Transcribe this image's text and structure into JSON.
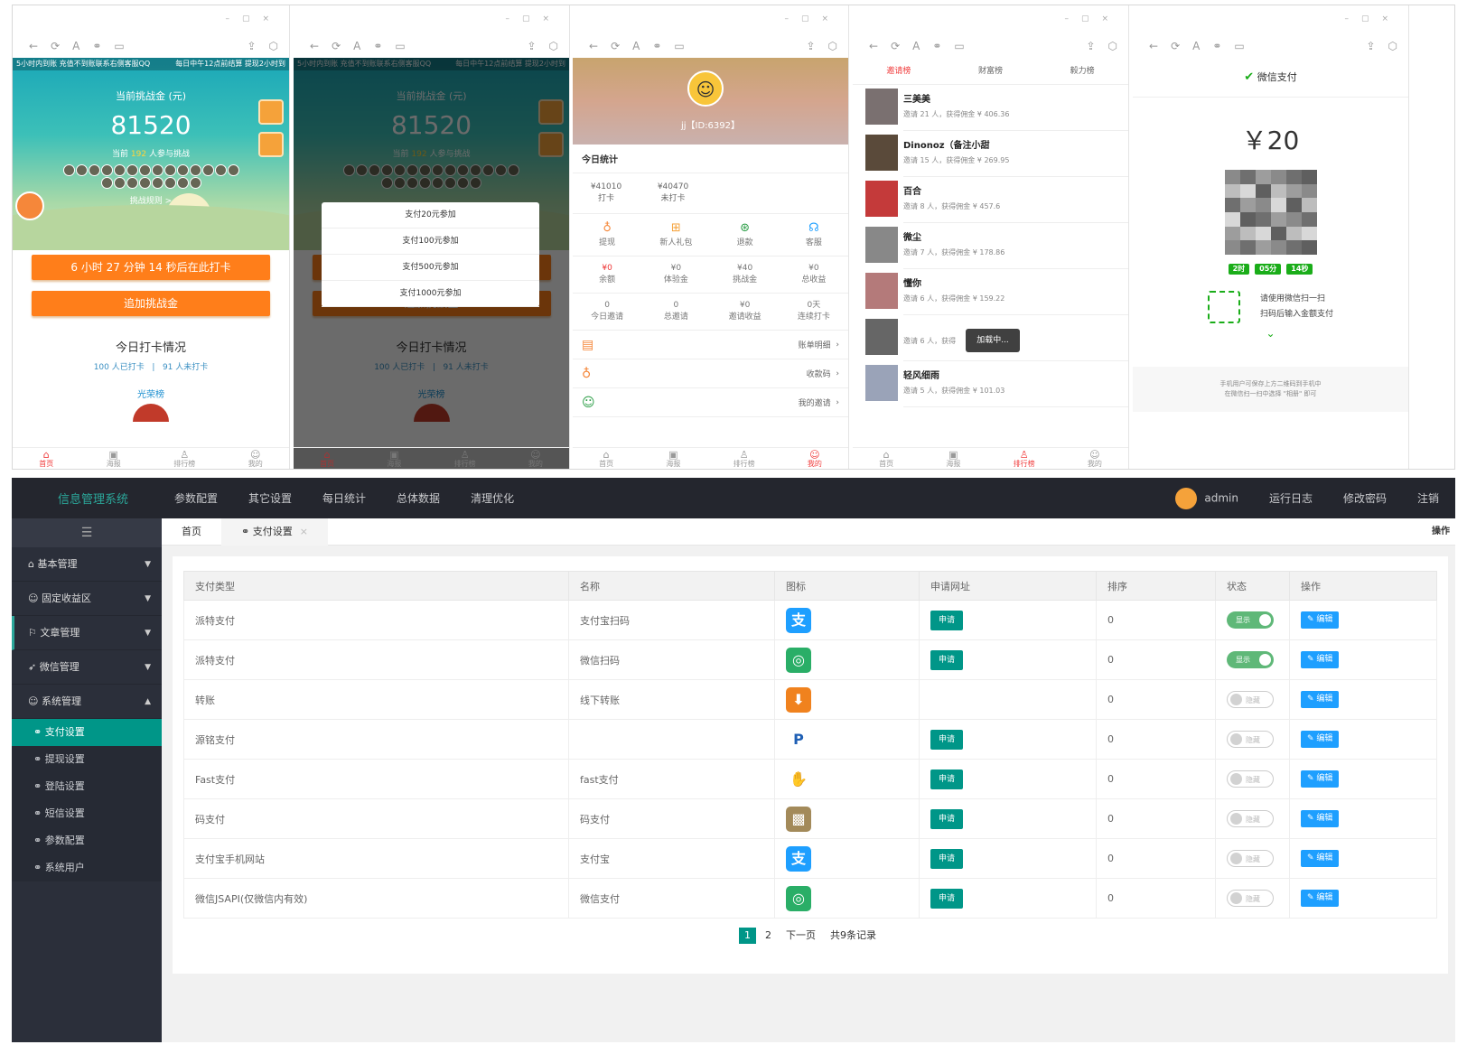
{
  "phones": {
    "p1": {
      "marquee_left": "5小时内到账 充值不到账联系右侧客服QQ",
      "marquee_right": "每日中午12点前结算 提现2小时到",
      "challenge_label": "当前挑战金 (元)",
      "amount": "81520",
      "participants_prefix": "当前",
      "participants": "192",
      "participants_suffix": "人参与挑战",
      "rule_link": "挑战规则 >",
      "countdown_button": "6 小时 27 分钟 14 秒后在此打卡",
      "add_button": "追加挑战金",
      "today_title": "今日打卡情况",
      "checked_in": "100 人已打卡",
      "not_checked": "91 人未打卡",
      "glory": "光荣榜"
    },
    "p2": {
      "options": [
        "支付20元参加",
        "支付100元参加",
        "支付500元参加",
        "支付1000元参加"
      ]
    },
    "p3": {
      "user": "jj【ID:6392】",
      "today_stats": "今日统计",
      "stats": [
        {
          "v": "¥41010",
          "l": "打卡"
        },
        {
          "v": "¥40470",
          "l": "未打卡"
        }
      ],
      "actions": [
        "提现",
        "新人礼包",
        "退款",
        "客服"
      ],
      "balances": [
        {
          "v": "¥0",
          "l": "余额"
        },
        {
          "v": "¥0",
          "l": "体验金"
        },
        {
          "v": "¥40",
          "l": "挑战金"
        },
        {
          "v": "¥0",
          "l": "总收益"
        }
      ],
      "invites": [
        {
          "v": "0",
          "l": "今日邀请"
        },
        {
          "v": "0",
          "l": "总邀请"
        },
        {
          "v": "¥0",
          "l": "邀请收益"
        },
        {
          "v": "0天",
          "l": "连续打卡"
        }
      ],
      "menu": [
        "账单明细",
        "收款码",
        "我的邀请"
      ]
    },
    "p4": {
      "tabs": [
        "邀请榜",
        "财富榜",
        "毅力榜"
      ],
      "rows": [
        {
          "name": "三美美",
          "desc": "邀请 21 人，获得佣金 ¥ 406.36"
        },
        {
          "name": "Dinonoz（备注小甜",
          "desc": "邀请 15 人，获得佣金 ¥ 269.95"
        },
        {
          "name": "百合",
          "desc": "邀请 8 人，获得佣金 ¥ 457.6"
        },
        {
          "name": "微尘",
          "desc": "邀请 7 人，获得佣金 ¥ 178.86"
        },
        {
          "name": "懂你",
          "desc": "邀请 6 人，获得佣金 ¥ 159.22"
        },
        {
          "name": "",
          "desc": "邀请 6 人，获得"
        },
        {
          "name": "轻风细雨",
          "desc": "邀请 5 人，获得佣金 ¥ 101.03"
        }
      ],
      "loading": "加载中..."
    },
    "p5": {
      "title": "微信支付",
      "amount": "￥20",
      "timer": [
        "2时",
        "05分",
        "14秒"
      ],
      "scan_line1": "请使用微信扫一扫",
      "scan_line2": "扫码后输入金额支付",
      "note1": "手机用户可保存上方二维码到手机中",
      "note2": "在微信扫一扫中选择 \"相册\" 即可"
    },
    "nav": [
      "首页",
      "海报",
      "排行榜",
      "我的"
    ]
  },
  "admin": {
    "logo": "信息管理系统",
    "nav": [
      "参数配置",
      "其它设置",
      "每日统计",
      "总体数据",
      "清理优化"
    ],
    "user": "admin",
    "right": [
      "运行日志",
      "修改密码",
      "注销"
    ],
    "sidebar": {
      "groups": [
        "基本管理",
        "固定收益区",
        "文章管理",
        "微信管理",
        "系统管理"
      ],
      "subs": [
        "支付设置",
        "提现设置",
        "登陆设置",
        "短信设置",
        "参数配置",
        "系统用户"
      ]
    },
    "tabs": {
      "home": "首页",
      "current": "支付设置",
      "ops": "操作"
    },
    "table": {
      "headers": [
        "支付类型",
        "名称",
        "图标",
        "申请网址",
        "排序",
        "状态",
        "操作"
      ],
      "apply_label": "申请",
      "edit_label": "编辑",
      "show_label": "显示",
      "hide_label": "隐藏",
      "rows": [
        {
          "type": "派特支付",
          "name": "支付宝扫码",
          "icon": "alipay-icon",
          "apply": true,
          "sort": "0",
          "on": true
        },
        {
          "type": "派特支付",
          "name": "微信扫码",
          "icon": "wechat-icon",
          "apply": true,
          "sort": "0",
          "on": true
        },
        {
          "type": "转账",
          "name": "线下转账",
          "icon": "download-icon",
          "apply": false,
          "sort": "0",
          "on": false
        },
        {
          "type": "源铭支付",
          "name": "",
          "icon": "paypal-icon",
          "apply": true,
          "sort": "0",
          "on": false
        },
        {
          "type": "Fast支付",
          "name": "fast支付",
          "icon": "fast-icon",
          "apply": true,
          "sort": "0",
          "on": false
        },
        {
          "type": "码支付",
          "name": "码支付",
          "icon": "code-pay-icon",
          "apply": true,
          "sort": "0",
          "on": false
        },
        {
          "type": "支付宝手机网站",
          "name": "支付宝",
          "icon": "alipay-icon",
          "apply": true,
          "sort": "0",
          "on": false
        },
        {
          "type": "微信JSAPI(仅微信内有效)",
          "name": "微信支付",
          "icon": "wechat-icon",
          "apply": true,
          "sort": "0",
          "on": false
        }
      ]
    },
    "pager": {
      "pages": [
        "1",
        "2"
      ],
      "next": "下一页",
      "total": "共9条记录"
    },
    "colors": {
      "teal": "#009688",
      "blue": "#1e9fff",
      "green": "#5fb878",
      "orange": "#ff7e1a",
      "dark": "#24262e"
    }
  }
}
